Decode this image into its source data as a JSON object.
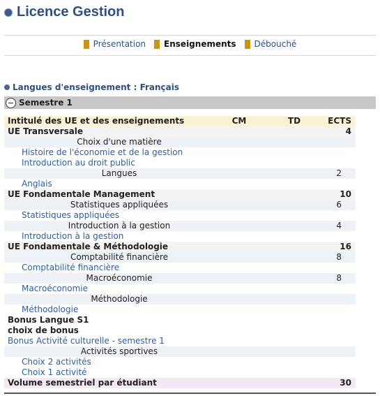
{
  "header": {
    "title": "Licence Gestion"
  },
  "tabs": [
    {
      "label": "Présentation",
      "active": false
    },
    {
      "label": "Enseignements",
      "active": true
    },
    {
      "label": "Débouché",
      "active": false
    }
  ],
  "language": {
    "text": "Langues d'enseignement : Français"
  },
  "semester": {
    "label": "Semestre 1"
  },
  "table": {
    "headers": {
      "title": "Intitulé des UE et des enseignements",
      "cm": "CM",
      "td": "TD",
      "ects": "ECTS"
    },
    "rows": [
      {
        "kind": "ue",
        "label": "UE Transversale",
        "ects": "4"
      },
      {
        "kind": "choice",
        "label": "Choix d'une matière",
        "ects": ""
      },
      {
        "kind": "sub",
        "label": "Histoire de l'économie et de la gestion",
        "ects": ""
      },
      {
        "kind": "sub",
        "label": "Introduction au droit public",
        "ects": ""
      },
      {
        "kind": "choice",
        "label": "Langues",
        "ects": "2"
      },
      {
        "kind": "sub",
        "label": "Anglais",
        "ects": ""
      },
      {
        "kind": "ue",
        "label": "UE Fondamentale Management",
        "ects": "10"
      },
      {
        "kind": "choice",
        "label": "Statistiques appliquées",
        "ects": "6"
      },
      {
        "kind": "sub",
        "label": "Statistiques appliquées",
        "ects": ""
      },
      {
        "kind": "choice",
        "label": "Introduction à la gestion",
        "ects": "4"
      },
      {
        "kind": "sub",
        "label": "Introduction à la gestion",
        "ects": ""
      },
      {
        "kind": "ue",
        "label": "UE Fondamentale & Méthodologie",
        "ects": "16"
      },
      {
        "kind": "choice",
        "label": "Comptabilité financière",
        "ects": "8"
      },
      {
        "kind": "sub",
        "label": "Comptabilité financière",
        "ects": ""
      },
      {
        "kind": "choice",
        "label": "Macroéconomie",
        "ects": "8"
      },
      {
        "kind": "sub",
        "label": "Macroéconomie",
        "ects": ""
      },
      {
        "kind": "choice",
        "label": "Méthodologie",
        "ects": ""
      },
      {
        "kind": "sub",
        "label": "Méthodologie",
        "ects": ""
      },
      {
        "kind": "bold",
        "label": "Bonus Langue S1",
        "ects": ""
      },
      {
        "kind": "bold",
        "label": "choix de bonus",
        "ects": ""
      },
      {
        "kind": "link",
        "label": "Bonus Activité culturelle - semestre 1",
        "ects": ""
      },
      {
        "kind": "choice",
        "label": "Activités sportives",
        "ects": ""
      },
      {
        "kind": "sub",
        "label": "Choix 2 activités",
        "ects": ""
      },
      {
        "kind": "sub",
        "label": "Choix 1 activité",
        "ects": ""
      }
    ],
    "footer": {
      "label": "Volume semestriel par étudiant",
      "ects": "30"
    }
  }
}
